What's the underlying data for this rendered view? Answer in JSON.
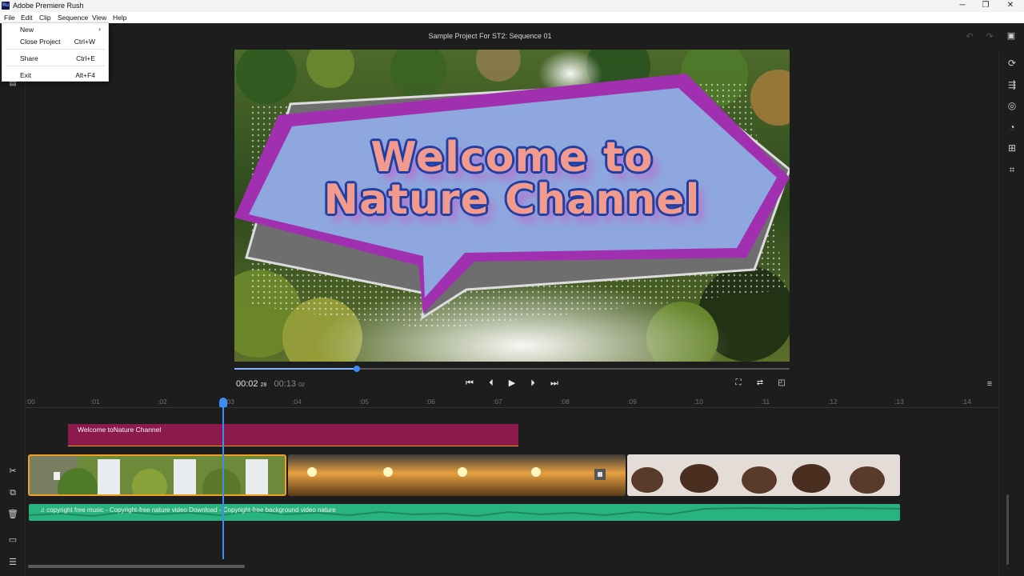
{
  "titlebar": {
    "app_icon": "Ru",
    "title": "Adobe Premiere Rush",
    "minimize": "─",
    "maximize": "❐",
    "close": "✕"
  },
  "menubar": {
    "items": [
      "File",
      "Edit",
      "Clip",
      "Sequence",
      "View",
      "Help"
    ]
  },
  "file_menu": {
    "items": [
      {
        "label": "New",
        "shortcut": "›"
      },
      {
        "label": "Close Project",
        "shortcut": "Ctrl+W"
      },
      {
        "label": "Share",
        "shortcut": "Ctrl+E"
      },
      {
        "label": "Exit",
        "shortcut": "Alt+F4"
      }
    ]
  },
  "header": {
    "sequence_title": "Sample Project For ST2: Sequence 01"
  },
  "preview": {
    "title_line1": "Welcome to",
    "title_line2": "Nature Channel"
  },
  "transport": {
    "current_time": "00:02",
    "current_frames": "28",
    "duration": "00:13",
    "duration_frames": "02",
    "progress": 0.22
  },
  "ruler": {
    "ticks": [
      ":00",
      ":01",
      ":02",
      ":03",
      ":04",
      ":05",
      ":06",
      ":07",
      ":08",
      ":09",
      ":10",
      ":11",
      ":12",
      ":13",
      ":14"
    ]
  },
  "timeline": {
    "title_clip": "Welcome toNature Channel",
    "audio_clip": "♫ copyright free music - Copyright-free nature video Download - Copyright-free background video nature"
  },
  "icons": {
    "undo": "undo-icon",
    "redo": "redo-icon",
    "comment": "comment-icon"
  },
  "colors": {
    "accent": "#3d8cf5",
    "title_clip": "#8c1a4d",
    "audio_clip": "#29b37e",
    "selected_clip_border": "#f0a020"
  }
}
